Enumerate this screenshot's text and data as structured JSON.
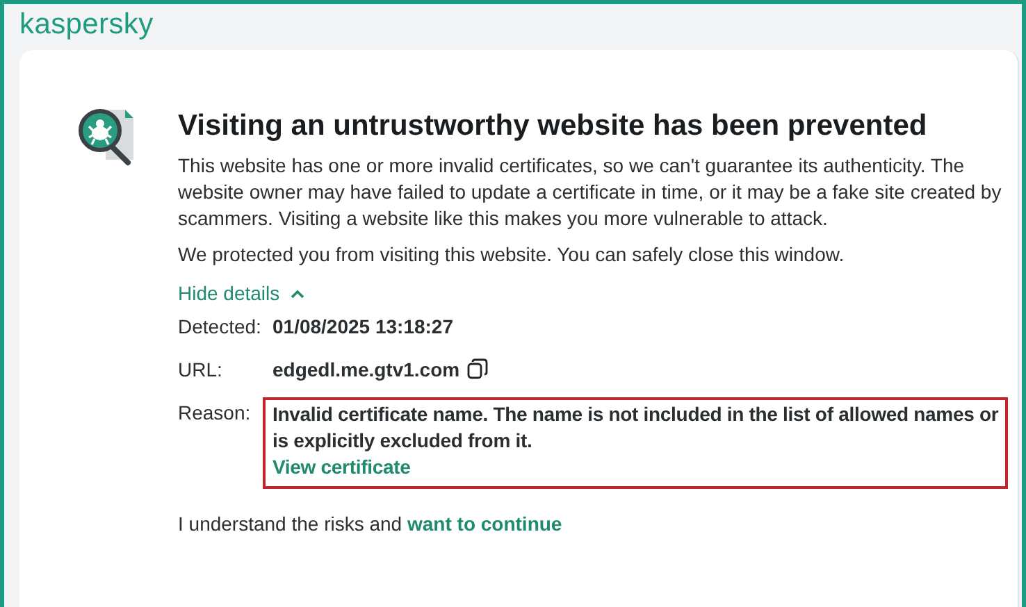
{
  "brand": "kaspersky",
  "title": "Visiting an untrustworthy website has been prevented",
  "description": "This website has one or more invalid certificates, so we can't guarantee its authenticity. The website owner may have failed to update a certificate in time, or it may be a fake site created by scammers. Visiting a website like this makes you more vulnerable to attack.",
  "note": "We protected you from visiting this website. You can safely close this window.",
  "details_toggle": {
    "label": "Hide details",
    "expanded": true
  },
  "details": [
    {
      "kind": "text",
      "label": "Detected:",
      "value": "01/08/2025 13:18:27"
    },
    {
      "kind": "copy",
      "label": "URL:",
      "value": "edgedl.me.gtv1.com"
    },
    {
      "kind": "highlighted",
      "label": "Reason:",
      "value": "Invalid certificate name. The name is not included in the list of allowed names or is explicitly excluded from it.",
      "link": "View certificate"
    }
  ],
  "footer": {
    "text": "I understand the risks and",
    "link": "want to continue"
  }
}
